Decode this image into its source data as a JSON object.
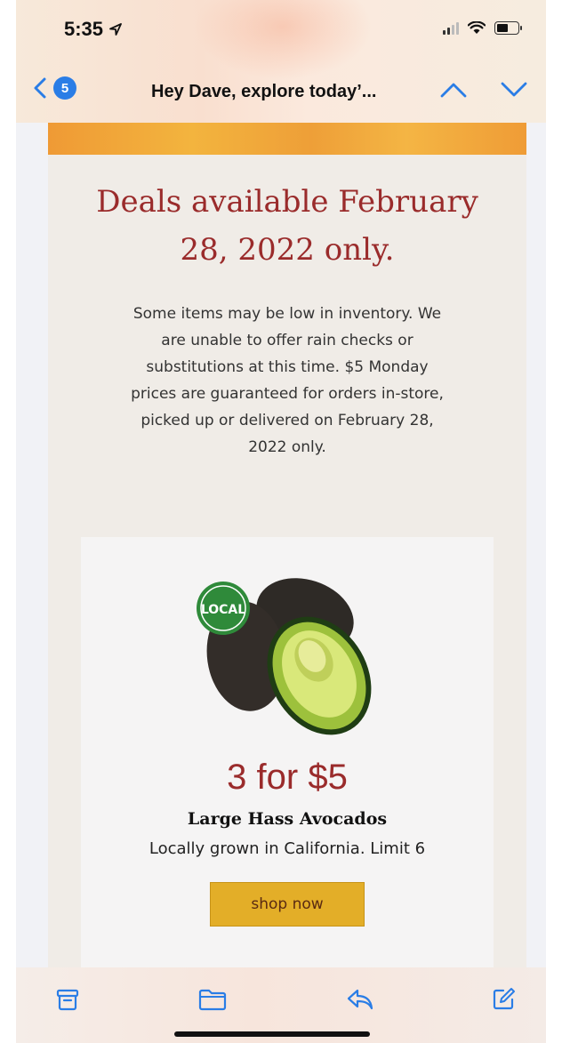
{
  "status_bar": {
    "time": "5:35"
  },
  "nav": {
    "back_count": "5",
    "subject": "Hey Dave, explore today’..."
  },
  "email": {
    "headline_line1": "Deals available February",
    "headline_line2": "28, 2022 only.",
    "disclaimer_lines": [
      "Some items may be low in inventory. We",
      "are unable to offer rain checks or",
      "substitutions at this time. $5 Monday",
      "prices are guaranteed for orders in-store,",
      "picked up or delivered on February 28,",
      "2022 only."
    ],
    "product": {
      "badge_text": "LOCAL",
      "price": "3 for $5",
      "name": "Large Hass Avocados",
      "description": "Locally grown in California. Limit 6",
      "button_label": "shop now"
    }
  },
  "colors": {
    "accent_red": "#9a2b2b",
    "button_yellow": "#e3ae28",
    "ios_blue": "#2a7de6"
  }
}
